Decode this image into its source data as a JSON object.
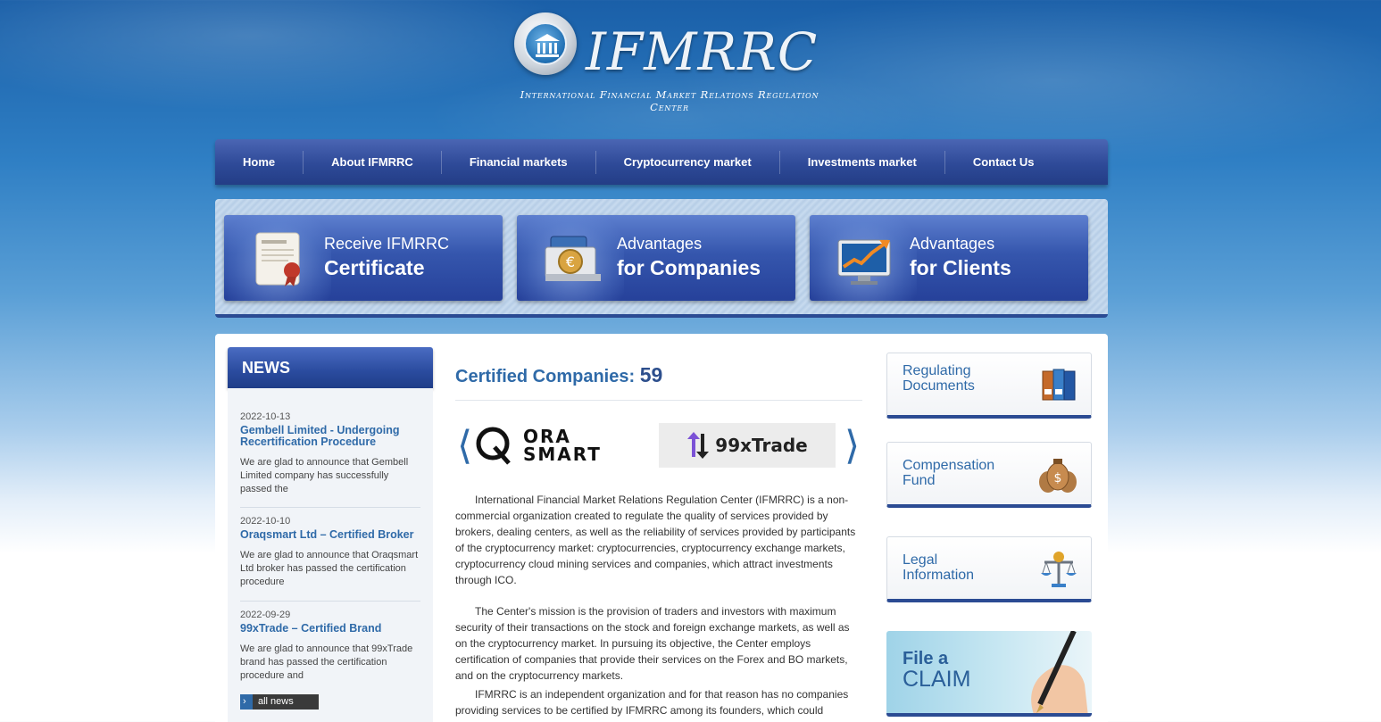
{
  "header": {
    "logo_text": "IFMRRC",
    "subtitle": "International Financial Market Relations Regulation Center"
  },
  "nav": {
    "items": [
      {
        "label": "Home"
      },
      {
        "label": "About IFMRRC"
      },
      {
        "label": "Financial markets"
      },
      {
        "label": "Cryptocurrency market"
      },
      {
        "label": "Investments market"
      },
      {
        "label": "Contact Us"
      }
    ]
  },
  "promo": [
    {
      "line1": "Receive IFMRRC",
      "line2": "Certificate",
      "icon": "certificate-icon"
    },
    {
      "line1": "Advantages",
      "line2": "for Companies",
      "icon": "euro-case-icon"
    },
    {
      "line1": "Advantages",
      "line2": "for Clients",
      "icon": "chart-monitor-icon"
    }
  ],
  "news": {
    "heading": "NEWS",
    "items": [
      {
        "date": "2022-10-13",
        "title": "Gembell Limited - Undergoing Recertification Procedure",
        "text": "We are glad to announce that Gembell Limited company has successfully passed the"
      },
      {
        "date": "2022-10-10",
        "title": "Oraqsmart Ltd – Certified Broker",
        "text": "We are glad to announce that Oraqsmart Ltd broker has passed the certification procedure"
      },
      {
        "date": "2022-09-29",
        "title": "99xTrade – Certified Brand",
        "text": "We are glad to announce that 99xTrade brand has passed the certification procedure and"
      }
    ],
    "all_news": "all news"
  },
  "certified": {
    "label": "Certified Companies:",
    "count": "59",
    "logos": [
      {
        "line1": "ORA",
        "line2": "SMART",
        "mark": "Q"
      },
      {
        "text": "99xTrade"
      }
    ]
  },
  "paragraphs": [
    "International Financial Market Relations Regulation Center (IFMRRC) is a non-commercial organization created to regulate the quality of services provided by brokers, dealing centers, as well as the reliability of services provided by participants of the cryptocurrency market: cryptocurrencies, cryptocurrency exchange markets, cryptocurrency cloud mining services and companies, which attract investments through ICO.",
    "The Center's mission is the provision of traders and investors with maximum security of their transactions on the stock and foreign exchange markets, as well as on the cryptocurrency market. In pursuing its objective, the Center employs certification of companies that provide their services on the Forex and BO markets, and on the cryptocurrency markets.",
    "IFMRRC is an independent organization and for that reason has no companies providing services to be certified by IFMRRC among its founders, which could"
  ],
  "sidebar": {
    "boxes": [
      {
        "line1": "Regulating",
        "line2": "Documents",
        "icon": "binders-icon"
      },
      {
        "line1": "Compensation",
        "line2": "Fund",
        "icon": "money-bags-icon"
      },
      {
        "line1": "Legal",
        "line2": "Information",
        "icon": "scales-icon"
      }
    ],
    "claim": {
      "line1": "File a",
      "line2": "CLAIM",
      "icon": "pen-hand-icon"
    }
  }
}
